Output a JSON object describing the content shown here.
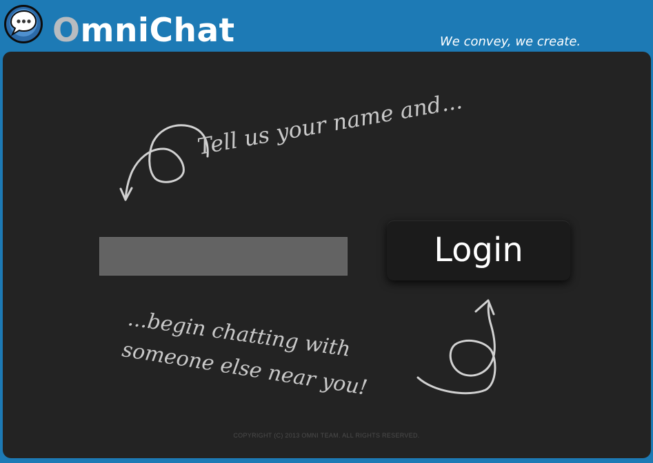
{
  "header": {
    "brand_first_letter": "O",
    "brand_rest": "mniChat",
    "tagline": "We convey, we create."
  },
  "main": {
    "hint_top": "Tell us your name and...",
    "hint_bottom_line1": "...begin chatting with",
    "hint_bottom_line2": "someone else near you!",
    "name_input": {
      "value": "",
      "placeholder": ""
    },
    "login_label": "Login"
  },
  "footer": {
    "copyright": "COPYRIGHT (C) 2013 OMNI TEAM. ALL RIGHTS RESERVED."
  },
  "icons": {
    "logo": "chat-bubble-icon",
    "arrow_top": "curly-arrow-down-icon",
    "arrow_bottom": "curly-arrow-up-icon"
  },
  "colors": {
    "header_bg": "#1d7ab5",
    "panel_bg": "#232323",
    "input_bg": "#636363",
    "button_bg": "#1b1b1b",
    "brand_letter": "#b8bcc0"
  }
}
